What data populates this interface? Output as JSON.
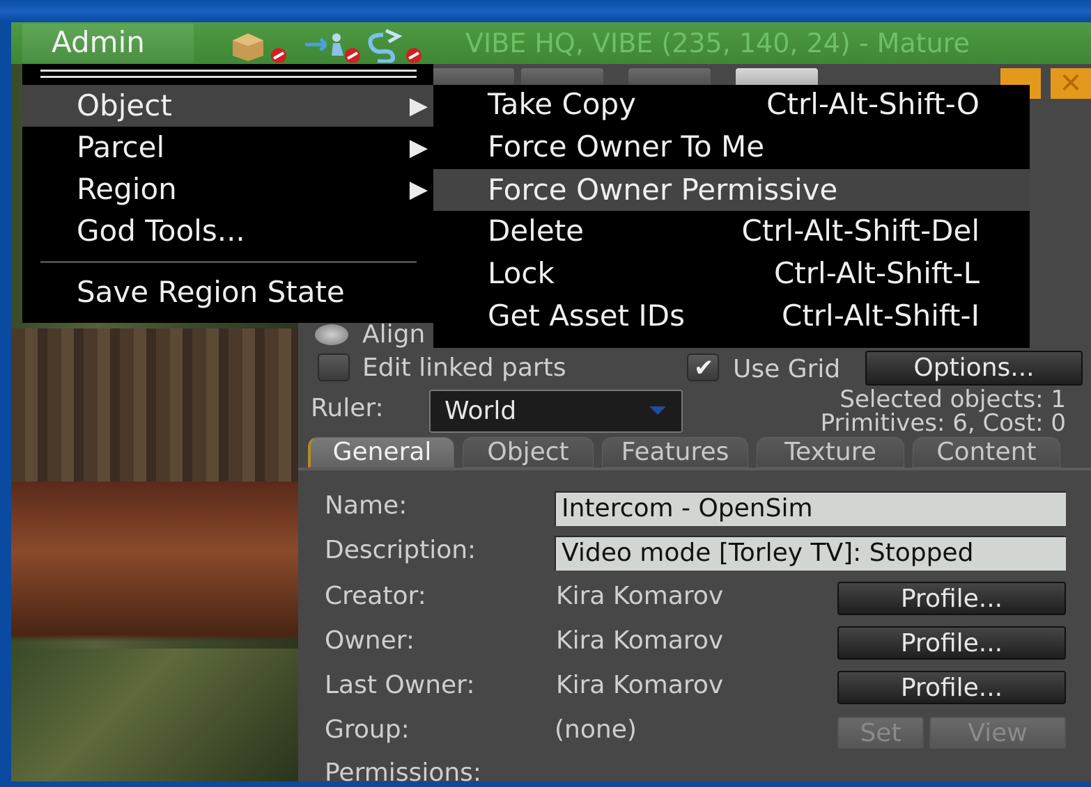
{
  "menubar": {
    "admin_label": "Admin",
    "location": "VIBE HQ, VIBE (235, 140, 24) - Mature"
  },
  "admin_menu": {
    "items": [
      {
        "label": "Object",
        "submenu": true,
        "highlighted": true
      },
      {
        "label": "Parcel",
        "submenu": true
      },
      {
        "label": "Region",
        "submenu": true
      },
      {
        "label": "God Tools...",
        "submenu": false
      },
      {
        "label": "Save Region State",
        "submenu": false
      }
    ],
    "arrow_glyph": "▶"
  },
  "object_submenu": {
    "items": [
      {
        "label": "Take Copy",
        "shortcut": "Ctrl-Alt-Shift-O"
      },
      {
        "label": "Force Owner To Me",
        "shortcut": ""
      },
      {
        "label": "Force Owner Permissive",
        "shortcut": "",
        "highlighted": true
      },
      {
        "label": "Delete",
        "shortcut": "Ctrl-Alt-Shift-Del"
      },
      {
        "label": "Lock",
        "shortcut": "Ctrl-Alt-Shift-L"
      },
      {
        "label": "Get Asset IDs",
        "shortcut": "Ctrl-Alt-Shift-I"
      }
    ]
  },
  "build_panel": {
    "align_label": "Align",
    "edit_linked_label": "Edit linked parts",
    "edit_linked_checked": false,
    "use_grid_label": "Use Grid",
    "use_grid_checked": true,
    "options_button": "Options...",
    "ruler_label": "Ruler:",
    "ruler_value": "World",
    "selected_objects": "Selected objects: 1",
    "primitives_cost": "Primitives: 6, Cost: 0",
    "tabs": [
      "General",
      "Object",
      "Features",
      "Texture",
      "Content"
    ],
    "active_tab": "General",
    "general": {
      "name_label": "Name:",
      "name_value": "Intercom - OpenSim",
      "description_label": "Description:",
      "description_value": "Video mode [Torley TV]: Stopped",
      "creator_label": "Creator:",
      "creator_value": "Kira Komarov",
      "owner_label": "Owner:",
      "owner_value": "Kira Komarov",
      "last_owner_label": "Last Owner:",
      "last_owner_value": "Kira Komarov",
      "profile_button": "Profile...",
      "group_label": "Group:",
      "group_value": "(none)",
      "set_button": "Set",
      "view_button": "View",
      "permissions_label": "Permissions:"
    }
  },
  "colors": {
    "menubar_green": "#4f9a43",
    "location_green": "#6ec066",
    "menu_bg": "#000000",
    "menu_highlight": "#434343",
    "panel_bg": "#474747",
    "window_frame_blue": "#0a4aa0",
    "close_orange": "#e39a1c"
  },
  "icons": [
    "object-icon",
    "fly-icon",
    "script-icon",
    "close-icon",
    "minimize-icon",
    "checkmark-icon",
    "submenu-arrow-icon"
  ]
}
